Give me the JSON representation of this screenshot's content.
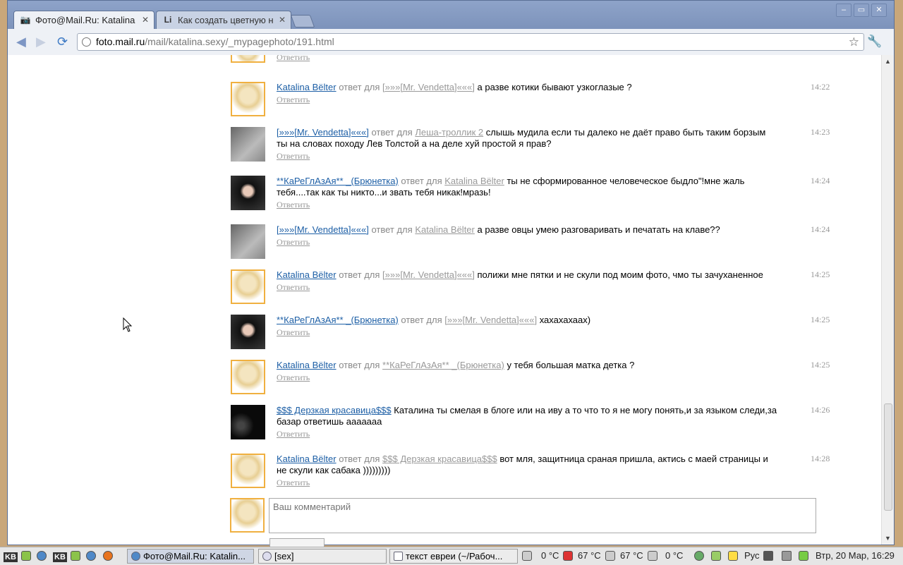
{
  "window": {
    "controls": [
      "minimize",
      "maximize",
      "close"
    ],
    "tabs": [
      {
        "title": "Фото@Mail.Ru: Katalina",
        "icon": "camera-icon",
        "active": true
      },
      {
        "title": "Как создать цветную н",
        "icon": "li-icon",
        "active": false
      }
    ]
  },
  "toolbar": {
    "url_host": "foto.mail.ru",
    "url_path": "/mail/katalina.sexy/_mypagephoto/191.html"
  },
  "comments": [
    {
      "author": "Katalina Bëlter",
      "to_word": "ответ для",
      "to_user": "[»»»[Mr. Vendetta]«««]",
      "text": "а разве котики бывают узкоглазые ?",
      "reply": "Ответить",
      "time": "14:22",
      "avatar": "blonde"
    },
    {
      "author": "[»»»[Mr. Vendetta]«««]",
      "to_word": "ответ для",
      "to_user": "Леша-троллик 2",
      "text": "слышь мудила если ты далеко не даёт право быть таким борзым ты на словах походу Лев Толстой а на деле хуй простой я прав?",
      "reply": "Ответить",
      "time": "14:23",
      "avatar": "gray"
    },
    {
      "author": "**КаРеГлАзАя** _(Брюнетка)",
      "to_word": "ответ для",
      "to_user": "Katalina Bëlter",
      "text": "ты не сформированное человеческое быдло\"!мне жаль тебя....так как ты никто...и звать тебя никак!мразь!",
      "reply": "Ответить",
      "time": "14:24",
      "avatar": "dark"
    },
    {
      "author": "[»»»[Mr. Vendetta]«««]",
      "to_word": "ответ для",
      "to_user": "Katalina Bëlter",
      "text": "а разве овцы умею разговаривать и печатать на клаве??",
      "reply": "Ответить",
      "time": "14:24",
      "avatar": "gray"
    },
    {
      "author": "Katalina Bëlter",
      "to_word": "ответ для",
      "to_user": "[»»»[Mr. Vendetta]«««]",
      "text": "полижи мне пятки и не скули под моим фото, чмо ты зачуханенное",
      "reply": "Ответить",
      "time": "14:25",
      "avatar": "blonde"
    },
    {
      "author": "**КаРеГлАзАя** _(Брюнетка)",
      "to_word": "ответ для",
      "to_user": "[»»»[Mr. Vendetta]«««]",
      "text": "хахахахаах)",
      "reply": "Ответить",
      "time": "14:25",
      "avatar": "dark"
    },
    {
      "author": "Katalina Bëlter",
      "to_word": "ответ для",
      "to_user": "**КаРеГлАзАя** _(Брюнетка)",
      "text": "у тебя большая матка детка ?",
      "reply": "Ответить",
      "time": "14:25",
      "avatar": "blonde"
    },
    {
      "author": "$$$ Дерзкая красавица$$$",
      "to_word": "",
      "to_user": "",
      "text": "Каталина ты смелая в блоге или на иву а то что то я не могу понять,и за языком следи,за базар ответишь ааааааа",
      "reply": "Ответить",
      "time": "14:26",
      "avatar": "night"
    },
    {
      "author": "Katalina Bëlter",
      "to_word": "ответ для",
      "to_user": "$$$ Дерзкая красавица$$$",
      "text": "вот мля, защитница сраная пришла, актись с маей страницы и не скули как сабака )))))))))",
      "reply": "Ответить",
      "time": "14:28",
      "avatar": "blonde"
    }
  ],
  "partial_top": {
    "reply": "Ответить"
  },
  "composer": {
    "placeholder": "Ваш комментарий"
  },
  "taskbar": {
    "kb_label": "KB",
    "tasks": [
      {
        "label": "Фото@Mail.Ru: Katalin...",
        "active": true
      },
      {
        "label": "[sex]",
        "active": false
      },
      {
        "label": "текст евреи (~/Рабоч...",
        "active": false
      }
    ],
    "sensors": [
      "0 °C",
      "67 °C",
      "67 °C",
      "0 °C"
    ],
    "language": "Рус",
    "clock": "Втр, 20 Мар, 16:29"
  }
}
